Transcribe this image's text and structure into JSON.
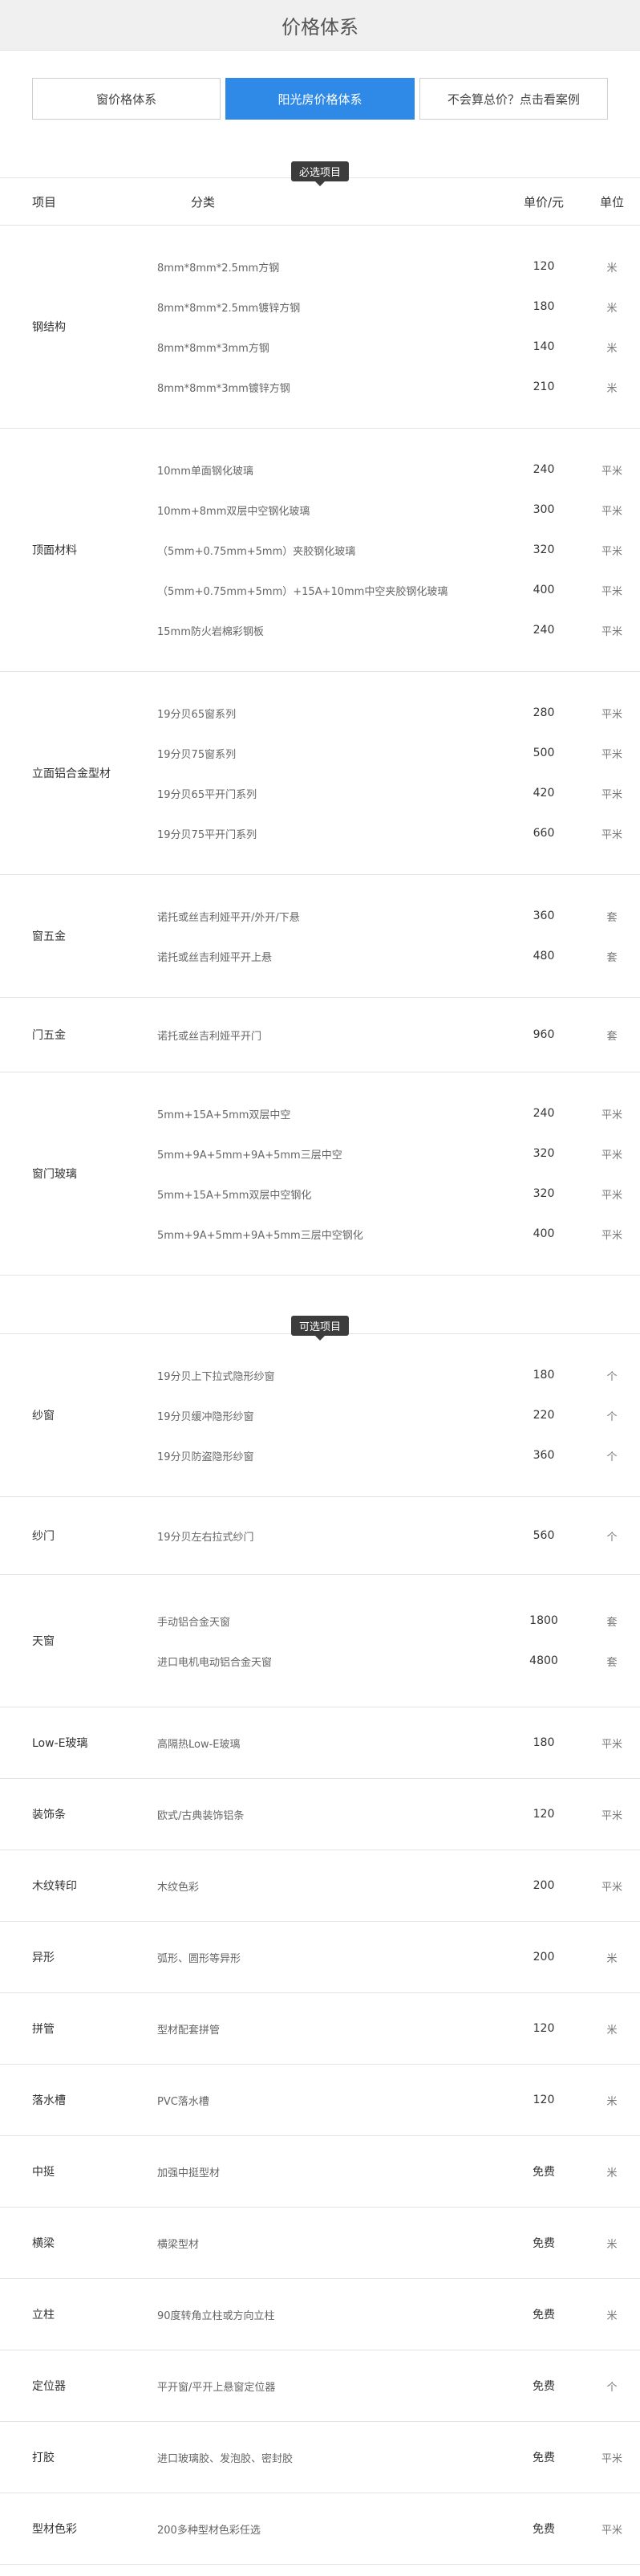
{
  "header": {
    "title": "价格体系"
  },
  "tabs": [
    {
      "label": "窗价格体系",
      "active": false
    },
    {
      "label": "阳光房价格体系",
      "active": true
    },
    {
      "label": "不会算总价？点击看案例",
      "active": false
    }
  ],
  "required": {
    "label": "必选项目",
    "columns": {
      "item": "项目",
      "category": "分类",
      "price": "单价/元",
      "unit": "单位"
    },
    "groups": [
      {
        "name": "钢结构",
        "rows": [
          {
            "category": "8mm*8mm*2.5mm方钢",
            "price": "120",
            "unit": "米"
          },
          {
            "category": "8mm*8mm*2.5mm镀锌方钢",
            "price": "180",
            "unit": "米"
          },
          {
            "category": "8mm*8mm*3mm方钢",
            "price": "140",
            "unit": "米"
          },
          {
            "category": "8mm*8mm*3mm镀锌方钢",
            "price": "210",
            "unit": "米"
          }
        ]
      },
      {
        "name": "顶面材料",
        "rows": [
          {
            "category": "10mm单面钢化玻璃",
            "price": "240",
            "unit": "平米"
          },
          {
            "category": "10mm+8mm双层中空钢化玻璃",
            "price": "300",
            "unit": "平米"
          },
          {
            "category": "（5mm+0.75mm+5mm）夹胶钢化玻璃",
            "price": "320",
            "unit": "平米"
          },
          {
            "category": "（5mm+0.75mm+5mm）+15A+10mm中空夹胶钢化玻璃",
            "price": "400",
            "unit": "平米"
          },
          {
            "category": "15mm防火岩棉彩钢板",
            "price": "240",
            "unit": "平米"
          }
        ]
      },
      {
        "name": "立面铝合金型材",
        "rows": [
          {
            "category": "19分贝65窗系列",
            "price": "280",
            "unit": "平米"
          },
          {
            "category": "19分贝75窗系列",
            "price": "500",
            "unit": "平米"
          },
          {
            "category": "19分贝65平开门系列",
            "price": "420",
            "unit": "平米"
          },
          {
            "category": "19分贝75平开门系列",
            "price": "660",
            "unit": "平米"
          }
        ]
      },
      {
        "name": "窗五金",
        "rows": [
          {
            "category": "诺托或丝吉利娅平开/外开/下悬",
            "price": "360",
            "unit": "套"
          },
          {
            "category": "诺托或丝吉利娅平开上悬",
            "price": "480",
            "unit": "套"
          }
        ]
      },
      {
        "name": "门五金",
        "rows": [
          {
            "category": "诺托或丝吉利娅平开门",
            "price": "960",
            "unit": "套"
          }
        ]
      },
      {
        "name": "窗门玻璃",
        "rows": [
          {
            "category": "5mm+15A+5mm双层中空",
            "price": "240",
            "unit": "平米"
          },
          {
            "category": "5mm+9A+5mm+9A+5mm三层中空",
            "price": "320",
            "unit": "平米"
          },
          {
            "category": "5mm+15A+5mm双层中空钢化",
            "price": "320",
            "unit": "平米"
          },
          {
            "category": "5mm+9A+5mm+9A+5mm三层中空钢化",
            "price": "400",
            "unit": "平米"
          }
        ]
      }
    ]
  },
  "optional": {
    "label": "可选项目",
    "groups": [
      {
        "name": "纱窗",
        "rows": [
          {
            "category": "19分贝上下拉式隐形纱窗",
            "price": "180",
            "unit": "个"
          },
          {
            "category": "19分贝缓冲隐形纱窗",
            "price": "220",
            "unit": "个"
          },
          {
            "category": "19分贝防盗隐形纱窗",
            "price": "360",
            "unit": "个"
          }
        ]
      },
      {
        "name": "纱门",
        "rows": [
          {
            "category": "19分贝左右拉式纱门",
            "price": "560",
            "unit": "个"
          }
        ]
      },
      {
        "name": "天窗",
        "rows": [
          {
            "category": "手动铝合金天窗",
            "price": "1800",
            "unit": "套"
          },
          {
            "category": "进口电机电动铝合金天窗",
            "price": "4800",
            "unit": "套"
          }
        ]
      },
      {
        "name": "Low-E玻璃",
        "rows": [
          {
            "category": "高隔热Low-E玻璃",
            "price": "180",
            "unit": "平米"
          }
        ]
      },
      {
        "name": "装饰条",
        "rows": [
          {
            "category": "欧式/古典装饰铝条",
            "price": "120",
            "unit": "平米"
          }
        ]
      },
      {
        "name": "木纹转印",
        "rows": [
          {
            "category": "木纹色彩",
            "price": "200",
            "unit": "平米"
          }
        ]
      },
      {
        "name": "异形",
        "rows": [
          {
            "category": "弧形、圆形等异形",
            "price": "200",
            "unit": "米"
          }
        ]
      },
      {
        "name": "拼管",
        "rows": [
          {
            "category": "型材配套拼管",
            "price": "120",
            "unit": "米"
          }
        ]
      },
      {
        "name": "落水槽",
        "rows": [
          {
            "category": "PVC落水槽",
            "price": "120",
            "unit": "米"
          }
        ]
      },
      {
        "name": "中挺",
        "rows": [
          {
            "category": "加强中挺型材",
            "price": "免费",
            "unit": "米"
          }
        ]
      },
      {
        "name": "横梁",
        "rows": [
          {
            "category": "横梁型材",
            "price": "免费",
            "unit": "米"
          }
        ]
      },
      {
        "name": "立柱",
        "rows": [
          {
            "category": "90度转角立柱或方向立柱",
            "price": "免费",
            "unit": "米"
          }
        ]
      },
      {
        "name": "定位器",
        "rows": [
          {
            "category": "平开窗/平开上悬窗定位器",
            "price": "免费",
            "unit": "个"
          }
        ]
      },
      {
        "name": "打胶",
        "rows": [
          {
            "category": "进口玻璃胶、发泡胶、密封胶",
            "price": "免费",
            "unit": "平米"
          }
        ]
      },
      {
        "name": "型材色彩",
        "rows": [
          {
            "category": "200多种型材色彩任选",
            "price": "免费",
            "unit": "平米"
          }
        ]
      }
    ]
  }
}
